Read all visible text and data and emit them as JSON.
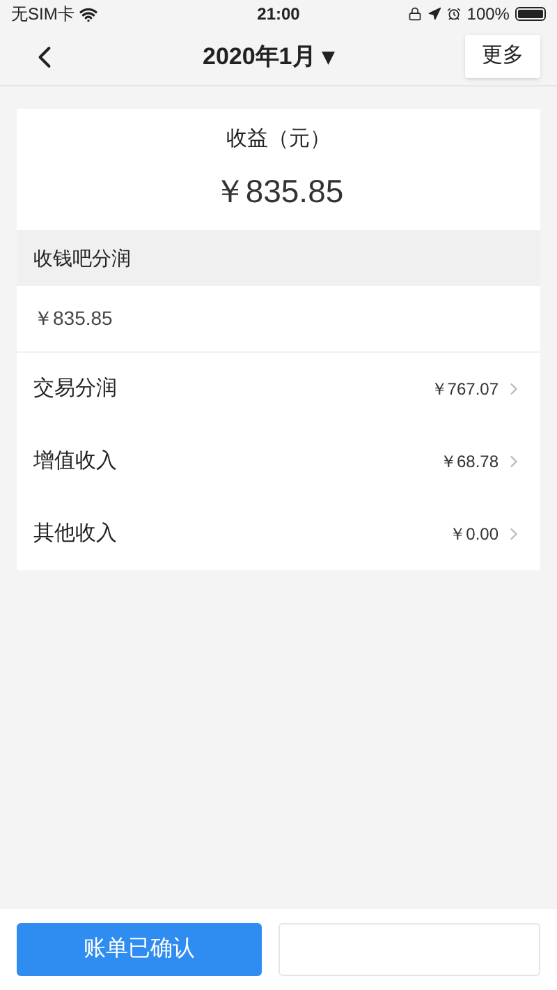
{
  "status_bar": {
    "carrier": "无SIM卡",
    "time": "21:00",
    "battery": "100%"
  },
  "nav": {
    "title": "2020年1月",
    "dropdown": "▾",
    "more": "更多"
  },
  "summary": {
    "label": "收益（元）",
    "amount": "￥835.85"
  },
  "section": {
    "title": "收钱吧分润",
    "total": "￥835.85",
    "rows": [
      {
        "label": "交易分润",
        "value": "￥767.07"
      },
      {
        "label": "增值收入",
        "value": "￥68.78"
      },
      {
        "label": "其他收入",
        "value": "￥0.00"
      }
    ]
  },
  "footer": {
    "confirm": "账单已确认"
  }
}
